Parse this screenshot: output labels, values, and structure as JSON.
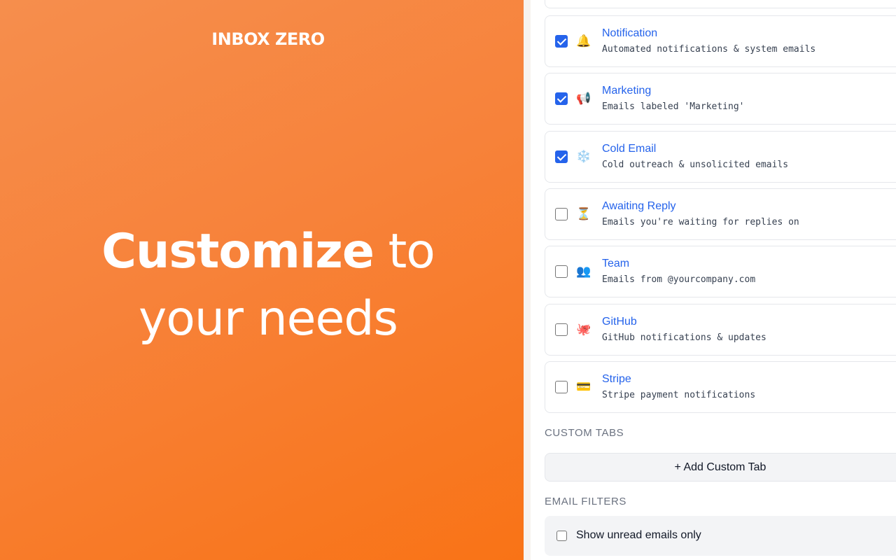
{
  "brand": {
    "name": "INBOX ZERO"
  },
  "headline": {
    "bold": "Customize",
    "rest_line1": " to",
    "line2": "your needs"
  },
  "tabs": [
    {
      "name": "Notification",
      "description": "Automated notifications & system emails",
      "emoji": "🔔",
      "icon": "bell-icon",
      "checked": true
    },
    {
      "name": "Marketing",
      "description": "Emails labeled 'Marketing'",
      "emoji": "📢",
      "icon": "megaphone-icon",
      "checked": true
    },
    {
      "name": "Cold Email",
      "description": "Cold outreach & unsolicited emails",
      "emoji": "❄️",
      "icon": "snowflake-icon",
      "checked": true
    },
    {
      "name": "Awaiting Reply",
      "description": "Emails you're waiting for replies on",
      "emoji": "⏳",
      "icon": "hourglass-icon",
      "checked": false
    },
    {
      "name": "Team",
      "description": "Emails from @yourcompany.com",
      "emoji": "👥",
      "icon": "people-icon",
      "checked": false
    },
    {
      "name": "GitHub",
      "description": "GitHub notifications & updates",
      "emoji": "🐙",
      "icon": "octopus-icon",
      "checked": false
    },
    {
      "name": "Stripe",
      "description": "Stripe payment notifications",
      "emoji": "💳",
      "icon": "credit-card-icon",
      "checked": false
    }
  ],
  "custom_tabs": {
    "title": "CUSTOM TABS",
    "add_label": "+ Add Custom Tab"
  },
  "email_filters": {
    "title": "EMAIL FILTERS",
    "unread_only_label": "Show unread emails only",
    "unread_only_checked": false
  },
  "colors": {
    "accent": "#2563eb",
    "gradient_start": "#f68e4d",
    "gradient_end": "#f97316"
  }
}
